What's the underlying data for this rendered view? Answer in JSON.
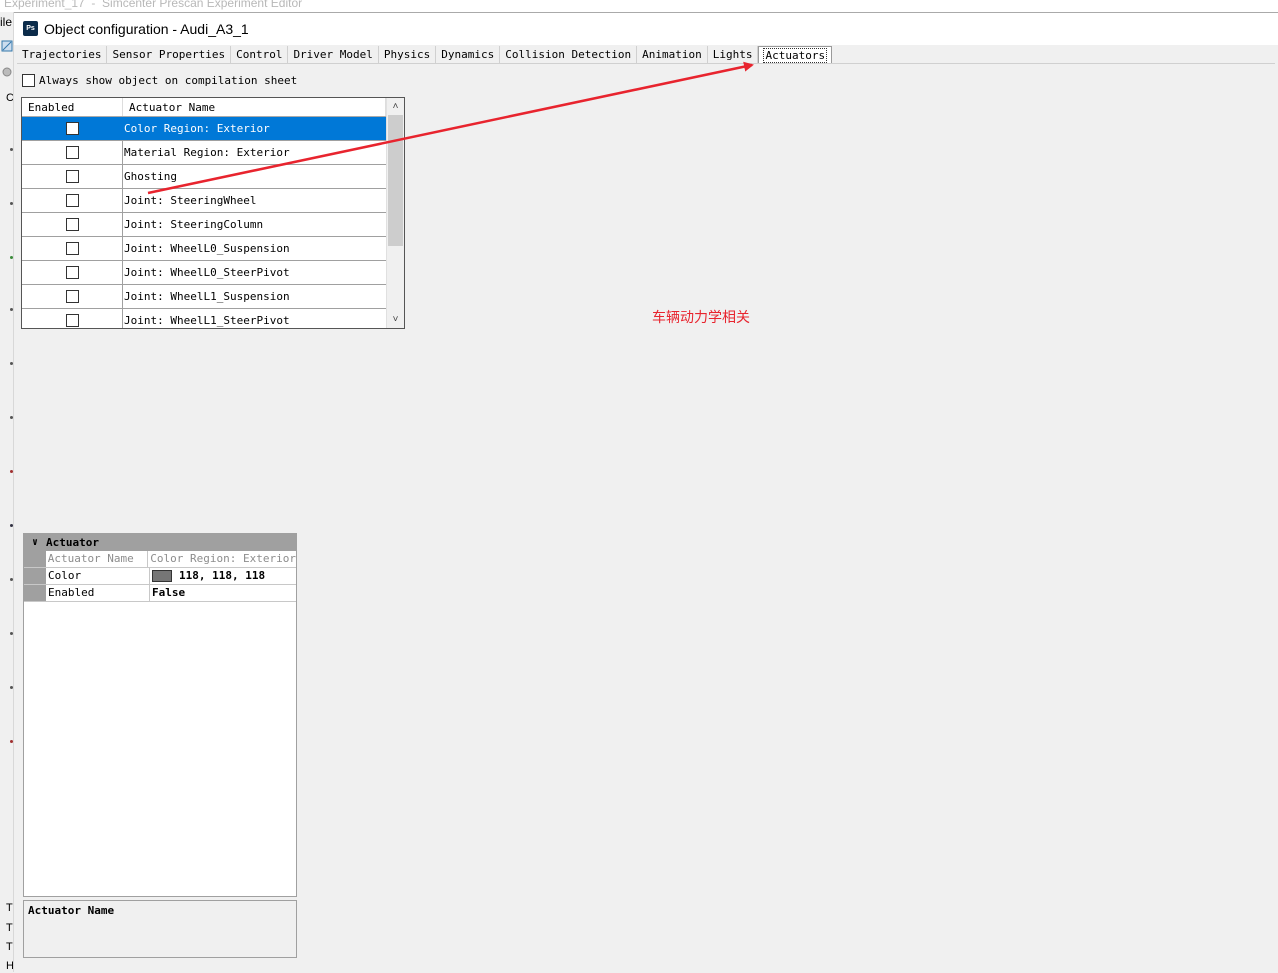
{
  "background": {
    "title_fragment": "Experiment_17  -  Simcenter Prescan Experiment Editor",
    "menu_fragment": "ile",
    "left_letter": "C",
    "bottom_letters": [
      "T",
      "T",
      "T",
      "H"
    ]
  },
  "window": {
    "icon_label": "Ps",
    "title": "Object configuration - Audi_A3_1"
  },
  "tabs": [
    {
      "label": "Trajectories"
    },
    {
      "label": "Sensor Properties"
    },
    {
      "label": "Control"
    },
    {
      "label": "Driver Model"
    },
    {
      "label": "Physics"
    },
    {
      "label": "Dynamics"
    },
    {
      "label": "Collision Detection"
    },
    {
      "label": "Animation"
    },
    {
      "label": "Lights"
    },
    {
      "label": "Actuators",
      "active": true
    }
  ],
  "always_show": {
    "label": "Always show object on compilation sheet",
    "checked": false
  },
  "actuator_grid": {
    "columns": [
      "Enabled",
      "Actuator Name"
    ],
    "rows": [
      {
        "enabled": false,
        "name": "Color Region: Exterior",
        "selected": true
      },
      {
        "enabled": false,
        "name": "Material Region: Exterior"
      },
      {
        "enabled": false,
        "name": "Ghosting"
      },
      {
        "enabled": false,
        "name": "Joint: SteeringWheel"
      },
      {
        "enabled": false,
        "name": "Joint: SteeringColumn"
      },
      {
        "enabled": false,
        "name": "Joint: WheelL0_Suspension"
      },
      {
        "enabled": false,
        "name": "Joint: WheelL0_SteerPivot"
      },
      {
        "enabled": false,
        "name": "Joint: WheelL1_Suspension"
      },
      {
        "enabled": false,
        "name": "Joint: WheelL1_SteerPivot"
      }
    ]
  },
  "annotation": {
    "text": "车辆动力学相关",
    "color": "#e8242e"
  },
  "property_grid": {
    "category": "Actuator",
    "rows": [
      {
        "name": "Actuator Name",
        "value": "Color Region: Exterior",
        "readonly": true
      },
      {
        "name": "Color",
        "value": "118, 118, 118",
        "swatch": "#767676"
      },
      {
        "name": "Enabled",
        "value": "False"
      }
    ]
  },
  "description": {
    "title": "Actuator Name"
  },
  "colors": {
    "selection": "#0078d7",
    "annotation_red": "#e8242e",
    "category_gray": "#a0a0a0"
  }
}
